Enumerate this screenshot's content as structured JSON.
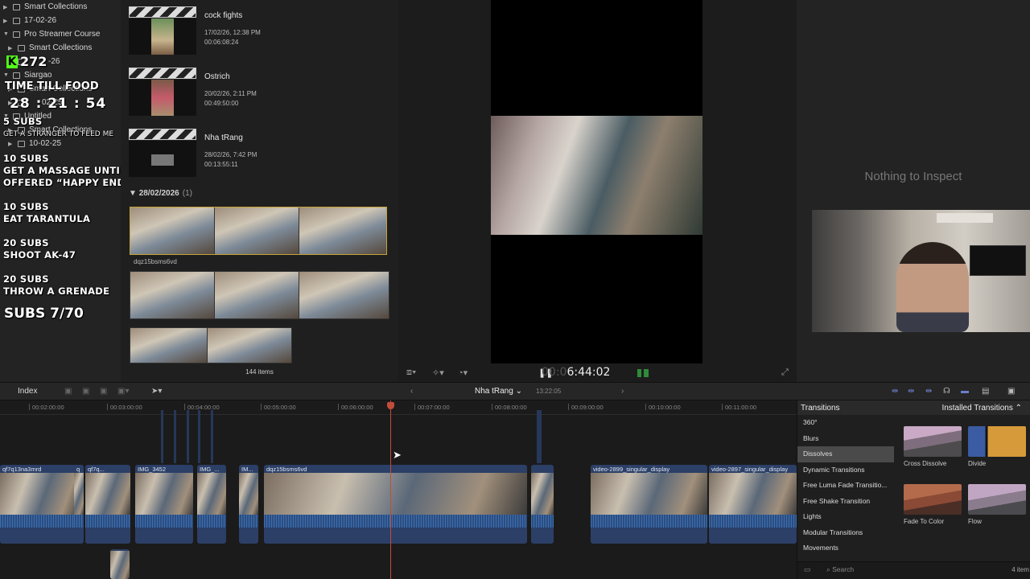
{
  "library": {
    "items": [
      {
        "label": "Smart Collections",
        "tri": "▶"
      },
      {
        "label": "17-02-26",
        "tri": "▶"
      },
      {
        "label": "Pro Streamer Course",
        "tri": "▼"
      },
      {
        "label": "Smart Collections",
        "tri": "▶"
      },
      {
        "label": "-26",
        "tri": "▶"
      },
      {
        "label": "Siargao",
        "tri": "▼"
      },
      {
        "label": "Smart Collections",
        "tri": "▶"
      },
      {
        "label": "02-25",
        "tri": "▶"
      },
      {
        "label": "Untitled",
        "tri": "▼"
      },
      {
        "label": "Smart Collections",
        "tri": "▶"
      },
      {
        "label": "10-02-25",
        "tri": "▶"
      }
    ]
  },
  "overlay": {
    "viewers": "272",
    "food_title": "TIME TILL FOOD",
    "timer": "28 : 21 : 54",
    "goals": [
      {
        "line1": "5 SUBS",
        "line2": ""
      },
      {
        "line1": "10 SUBS",
        "line2": "GET A MASSAGE UNTIL"
      },
      {
        "line1": "EAT TARANTULA",
        "line2": ""
      },
      {
        "line1": "20 SUBS",
        "line2": "SHOOT AK-47"
      },
      {
        "line1": "20 SUBS",
        "line2": "THROW A GRENADE"
      }
    ],
    "massage_extra": "OFFERED “HAPPY ENDING”",
    "tarantula_subs": "10 SUBS",
    "small_text": "GET A STRANGER TO FEED ME",
    "subs_total": "SUBS 7/70"
  },
  "browser": {
    "clips": [
      {
        "name": "cock fights",
        "date": "17/02/26, 12:38 PM",
        "duration": "00:06:08:24"
      },
      {
        "name": "Ostrich",
        "date": "20/02/26, 2:11 PM",
        "duration": "00:49:50:00"
      },
      {
        "name": "Nha tRang",
        "date": "28/02/26, 7:42 PM",
        "duration": "00:13:55:11"
      }
    ],
    "date_header": "28/02/2026",
    "date_count": "(1)",
    "clip_name": "dqz15bsms6vd",
    "items_count": "144 items"
  },
  "viewer": {
    "timecode_dim": "00:0",
    "timecode": "6:44:02"
  },
  "inspector": {
    "empty": "Nothing to Inspect"
  },
  "timeline_bar": {
    "index": "Index",
    "project": "Nha tRang",
    "duration": "13:22:05"
  },
  "ruler": [
    "00:02:00:00",
    "00:03:00:00",
    "00:04:00:00",
    "00:05:00:00",
    "00:06:00:00",
    "00:07:00:00",
    "00:08:00:00",
    "00:09:00:00",
    "00:10:00:00",
    "00:11:00:00"
  ],
  "clips": [
    "qf7q13na3mrd",
    "q",
    "qf7q...",
    "IMG_3452",
    "IMG_...",
    "IM...",
    "dqz15bsms6vd",
    "video-2899_singular_display",
    "video-2897_singular_display"
  ],
  "transitions": {
    "title": "Transitions",
    "installed": "Installed Transitions",
    "categories": [
      "360°",
      "Blurs",
      "Dissolves",
      "Dynamic Transitions",
      "Free Luma Fade Transitio...",
      "Free Shake Transition",
      "Lights",
      "Modular Transitions",
      "Movements"
    ],
    "selected": "Dissolves",
    "tiles": [
      "Cross Dissolve",
      "Divide",
      "Fade To Color",
      "Flow"
    ],
    "search_placeholder": "Search",
    "count": "4 item"
  },
  "colors": {
    "accent": "#6a7ec9",
    "playhead": "#c24c3a",
    "clip": "#2c3f66",
    "kick": "#53fc18"
  }
}
